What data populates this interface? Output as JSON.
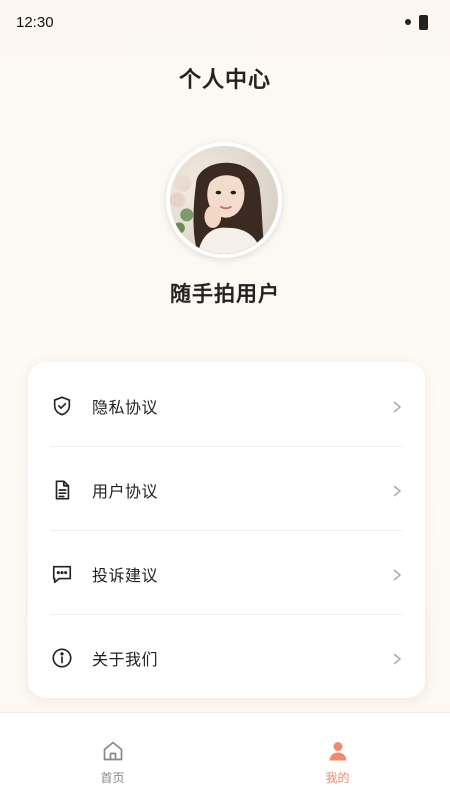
{
  "status_bar": {
    "time": "12:30"
  },
  "header": {
    "title": "个人中心"
  },
  "profile": {
    "username": "随手拍用户"
  },
  "menu": {
    "items": [
      {
        "label": "隐私协议",
        "icon": "shield-check-icon"
      },
      {
        "label": "用户协议",
        "icon": "document-icon"
      },
      {
        "label": "投诉建议",
        "icon": "message-icon"
      },
      {
        "label": "关于我们",
        "icon": "info-icon"
      }
    ]
  },
  "tab_bar": {
    "tabs": [
      {
        "label": "首页",
        "icon": "home-icon",
        "active": false
      },
      {
        "label": "我的",
        "icon": "user-icon",
        "active": true
      }
    ]
  },
  "colors": {
    "background": "#fdfaf4",
    "accent": "#ef8a6f",
    "inactive": "#888888",
    "text": "#222222"
  }
}
